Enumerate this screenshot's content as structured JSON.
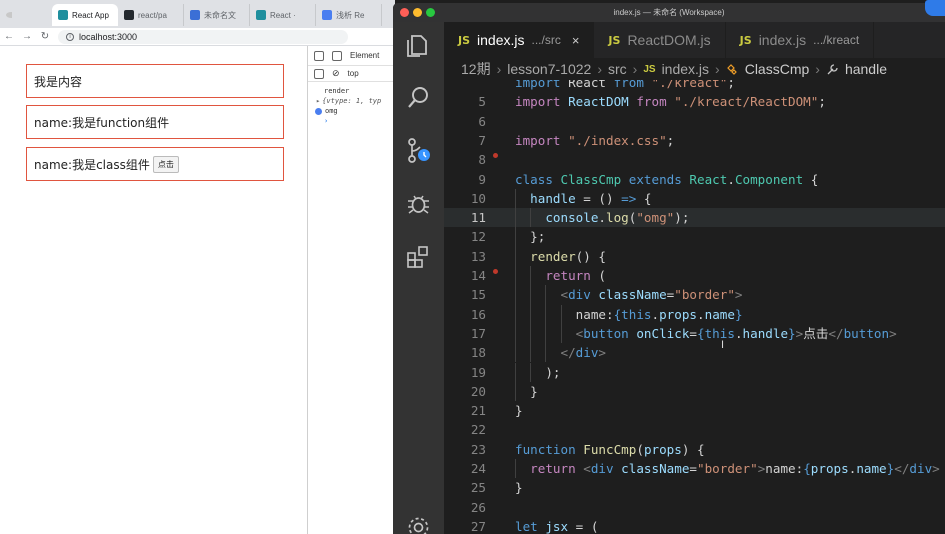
{
  "browser": {
    "tabs": [
      {
        "label": "React App",
        "favicon_color": "#1f8f9e",
        "active": true
      },
      {
        "label": "react/pa",
        "favicon_color": "#24292e",
        "active": false
      },
      {
        "label": "未命名文",
        "favicon_color": "#3b6fd6",
        "active": false
      },
      {
        "label": "React · ",
        "favicon_color": "#1f8f9e",
        "active": false
      },
      {
        "label": "浅析 Re",
        "favicon_color": "#4a7ef0",
        "active": false
      }
    ],
    "url": "localhost:3000",
    "page": {
      "content_text": "我是内容",
      "function_text": "name:我是function组件",
      "class_text": "name:我是class组件",
      "button_label": "点击"
    },
    "devtools": {
      "tab_label": "Element",
      "context": "top",
      "console": {
        "line1": "render",
        "line2": "{vtype: 1, typ",
        "line3": "omg",
        "prompt": "›"
      }
    }
  },
  "vscode": {
    "window_title": "index.js — 未命名 (Workspace)",
    "tabs": [
      {
        "badge": "JS",
        "name": "index.js",
        "desc": ".../src",
        "active": true,
        "close": "×"
      },
      {
        "badge": "JS",
        "name": "ReactDOM.js",
        "desc": "",
        "active": false,
        "close": ""
      },
      {
        "badge": "JS",
        "name": "index.js",
        "desc": ".../kreact",
        "active": false,
        "close": ""
      }
    ],
    "breadcrumbs": {
      "root": "12期",
      "folder": "lesson7-1022",
      "src": "src",
      "file_badge": "JS",
      "file": "index.js",
      "class_name": "ClassCmp",
      "method": "handle",
      "sep": "›"
    },
    "cursor_line": 11,
    "breakpoint_lines": [
      8,
      14
    ],
    "lines": [
      {
        "n": "",
        "tokens": [
          [
            "k",
            "import"
          ],
          [
            "p",
            " React "
          ],
          [
            "k",
            "from"
          ],
          [
            "s",
            " \"./kreact\""
          ],
          [
            "p",
            ";"
          ]
        ]
      },
      {
        "n": "5",
        "tokens": [
          [
            "c",
            "import"
          ],
          [
            "v",
            " ReactDOM"
          ],
          [
            "c",
            " from"
          ],
          [
            "s",
            " \"./kreact/ReactDOM\""
          ],
          [
            "p",
            ";"
          ]
        ]
      },
      {
        "n": "6",
        "tokens": []
      },
      {
        "n": "7",
        "tokens": [
          [
            "c",
            "import"
          ],
          [
            "s",
            " \"./index.css\""
          ],
          [
            "p",
            ";"
          ]
        ]
      },
      {
        "n": "8",
        "tokens": []
      },
      {
        "n": "9",
        "tokens": [
          [
            "k",
            "class"
          ],
          [
            "t",
            " ClassCmp"
          ],
          [
            "k",
            " extends"
          ],
          [
            "t",
            " React"
          ],
          [
            "p",
            "."
          ],
          [
            "t",
            "Component"
          ],
          [
            "p",
            " {"
          ]
        ]
      },
      {
        "n": "10",
        "tokens": [
          [
            "v",
            "  handle"
          ],
          [
            "p",
            " = () "
          ],
          [
            "k",
            "=>"
          ],
          [
            "p",
            " {"
          ]
        ]
      },
      {
        "n": "11",
        "tokens": [
          [
            "v",
            "    console"
          ],
          [
            "p",
            "."
          ],
          [
            "f",
            "log"
          ],
          [
            "p",
            "("
          ],
          [
            "s",
            "\"omg\""
          ],
          [
            "p",
            ");"
          ]
        ]
      },
      {
        "n": "12",
        "tokens": [
          [
            "p",
            "  };"
          ]
        ]
      },
      {
        "n": "13",
        "tokens": [
          [
            "f",
            "  render"
          ],
          [
            "p",
            "() {"
          ]
        ]
      },
      {
        "n": "14",
        "tokens": [
          [
            "c",
            "    return"
          ],
          [
            "p",
            " ("
          ]
        ]
      },
      {
        "n": "15",
        "tokens": [
          [
            "g",
            "      <"
          ],
          [
            "k",
            "div"
          ],
          [
            "v",
            " className"
          ],
          [
            "p",
            "="
          ],
          [
            "s",
            "\"border\""
          ],
          [
            "g",
            ">"
          ]
        ]
      },
      {
        "n": "16",
        "tokens": [
          [
            "p",
            "        name:"
          ],
          [
            "k",
            "{this"
          ],
          [
            "p",
            "."
          ],
          [
            "v",
            "props"
          ],
          [
            "p",
            "."
          ],
          [
            "v",
            "name"
          ],
          [
            "k",
            "}"
          ]
        ]
      },
      {
        "n": "17",
        "tokens": [
          [
            "g",
            "        <"
          ],
          [
            "k",
            "button"
          ],
          [
            "v",
            " onClick"
          ],
          [
            "p",
            "="
          ],
          [
            "k",
            "{this"
          ],
          [
            "p",
            "."
          ],
          [
            "v",
            "handle"
          ],
          [
            "k",
            "}"
          ],
          [
            "g",
            ">"
          ],
          [
            "p",
            "点击"
          ],
          [
            "g",
            "</"
          ],
          [
            "k",
            "button"
          ],
          [
            "g",
            ">"
          ]
        ]
      },
      {
        "n": "18",
        "tokens": [
          [
            "g",
            "      </"
          ],
          [
            "k",
            "div"
          ],
          [
            "g",
            ">"
          ]
        ]
      },
      {
        "n": "19",
        "tokens": [
          [
            "p",
            "    );"
          ]
        ]
      },
      {
        "n": "20",
        "tokens": [
          [
            "p",
            "  }"
          ]
        ]
      },
      {
        "n": "21",
        "tokens": [
          [
            "p",
            "}"
          ]
        ]
      },
      {
        "n": "22",
        "tokens": []
      },
      {
        "n": "23",
        "tokens": [
          [
            "k",
            "function"
          ],
          [
            "f",
            " FuncCmp"
          ],
          [
            "p",
            "("
          ],
          [
            "v",
            "props"
          ],
          [
            "p",
            ") {"
          ]
        ]
      },
      {
        "n": "24",
        "tokens": [
          [
            "c",
            "  return"
          ],
          [
            "g",
            " <"
          ],
          [
            "k",
            "div"
          ],
          [
            "v",
            " className"
          ],
          [
            "p",
            "="
          ],
          [
            "s",
            "\"border\""
          ],
          [
            "g",
            ">"
          ],
          [
            "p",
            "name:"
          ],
          [
            "k",
            "{"
          ],
          [
            "v",
            "props"
          ],
          [
            "p",
            "."
          ],
          [
            "v",
            "name"
          ],
          [
            "k",
            "}"
          ],
          [
            "g",
            "</"
          ],
          [
            "k",
            "div"
          ],
          [
            "g",
            ">"
          ]
        ]
      },
      {
        "n": "25",
        "tokens": [
          [
            "p",
            "}"
          ]
        ]
      },
      {
        "n": "26",
        "tokens": []
      },
      {
        "n": "27",
        "tokens": [
          [
            "k",
            "let"
          ],
          [
            "v",
            " jsx"
          ],
          [
            "p",
            " = ("
          ]
        ]
      }
    ]
  }
}
